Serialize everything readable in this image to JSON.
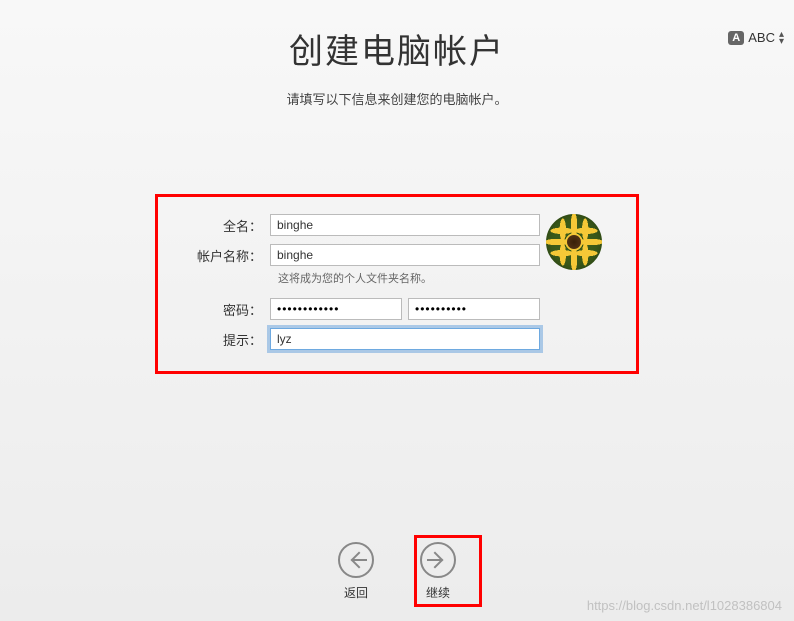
{
  "menubar": {
    "input_indicator": "A",
    "input_method": "ABC"
  },
  "header": {
    "title": "创建电脑帐户",
    "subtitle": "请填写以下信息来创建您的电脑帐户。"
  },
  "form": {
    "fullname_label": "全名：",
    "fullname_value": "binghe",
    "account_label": "帐户名称：",
    "account_value": "binghe",
    "account_hint": "这将成为您的个人文件夹名称。",
    "password_label": "密码：",
    "password_value": "••••••••••••",
    "password_confirm_value": "••••••••••",
    "hint_label": "提示：",
    "hint_value": "lyz"
  },
  "nav": {
    "back_label": "返回",
    "continue_label": "继续"
  },
  "watermark": "https://blog.csdn.net/l1028386804"
}
